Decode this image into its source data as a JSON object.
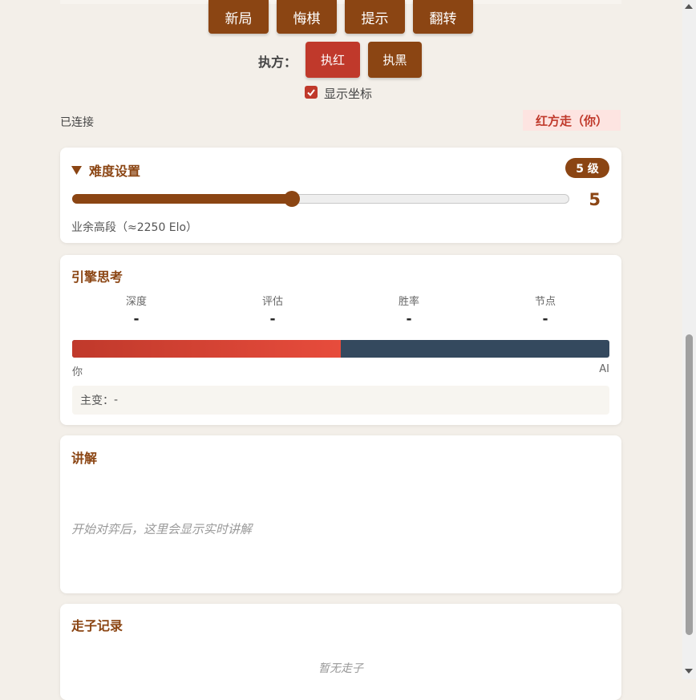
{
  "toolbar": {
    "new_game": "新局",
    "undo": "悔棋",
    "hint": "提示",
    "flip": "翻转"
  },
  "side": {
    "label": "执方：",
    "red": "执红",
    "black": "执黑"
  },
  "coords": {
    "label": "显示坐标",
    "checked": true
  },
  "status": {
    "connection": "已连接",
    "turn": "红方走（你）"
  },
  "difficulty": {
    "title": "难度设置",
    "badge": "5 级",
    "value": "5",
    "level_fraction": 0.44,
    "description": "业余高段（≈2250 Elo）"
  },
  "engine": {
    "title": "引擎思考",
    "stats": [
      {
        "label": "深度",
        "value": "-"
      },
      {
        "label": "评估",
        "value": "-"
      },
      {
        "label": "胜率",
        "value": "-"
      },
      {
        "label": "节点",
        "value": "-"
      }
    ],
    "red_share": 0.5,
    "left_label": "你",
    "right_label": "AI",
    "pv_label": "主变：",
    "pv_value": "-"
  },
  "commentary": {
    "title": "讲解",
    "placeholder": "开始对弈后，这里会显示实时讲解"
  },
  "moves": {
    "title": "走子记录",
    "empty": "暂无走子"
  },
  "colors": {
    "brown": "#8b4513",
    "red": "#c0392b",
    "dark_blue": "#34495e",
    "background": "#f3efe9"
  }
}
